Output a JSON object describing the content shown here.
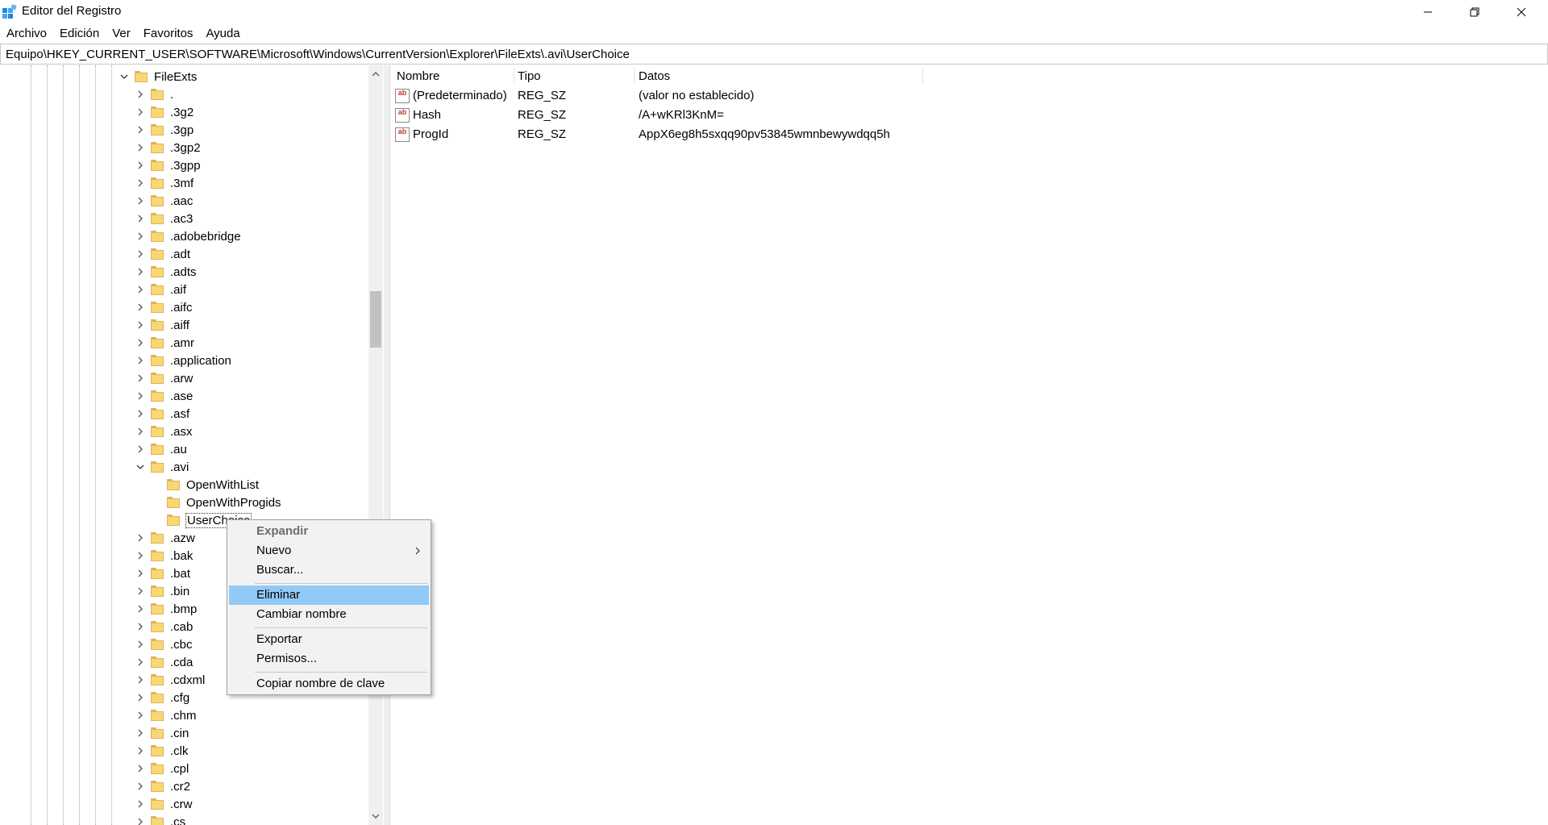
{
  "window": {
    "title": "Editor del Registro"
  },
  "menu": [
    "Archivo",
    "Edición",
    "Ver",
    "Favoritos",
    "Ayuda"
  ],
  "address": "Equipo\\HKEY_CURRENT_USER\\SOFTWARE\\Microsoft\\Windows\\CurrentVersion\\Explorer\\FileExts\\.avi\\UserChoice",
  "tree": {
    "root": "FileExts",
    "items": [
      ".",
      ".3g2",
      ".3gp",
      ".3gp2",
      ".3gpp",
      ".3mf",
      ".aac",
      ".ac3",
      ".adobebridge",
      ".adt",
      ".adts",
      ".aif",
      ".aifc",
      ".aiff",
      ".amr",
      ".application",
      ".arw",
      ".ase",
      ".asf",
      ".asx",
      ".au",
      ".avi"
    ],
    "avi_children": [
      "OpenWithList",
      "OpenWithProgids",
      "UserChoice"
    ],
    "items_after": [
      ".azw",
      ".bak",
      ".bat",
      ".bin",
      ".bmp",
      ".cab",
      ".cbc",
      ".cda",
      ".cdxml",
      ".cfg",
      ".chm",
      ".cin",
      ".clk",
      ".cpl",
      ".cr2",
      ".crw",
      ".cs"
    ]
  },
  "values": {
    "columns": [
      "Nombre",
      "Tipo",
      "Datos"
    ],
    "rows": [
      {
        "name": "(Predeterminado)",
        "type": "REG_SZ",
        "data": "(valor no establecido)"
      },
      {
        "name": "Hash",
        "type": "REG_SZ",
        "data": "/A+wKRl3KnM="
      },
      {
        "name": "ProgId",
        "type": "REG_SZ",
        "data": "AppX6eg8h5sxqq90pv53845wmnbewywdqq5h"
      }
    ]
  },
  "icon_text": "ab",
  "context_menu": {
    "expand": "Expandir",
    "new": "Nuevo",
    "find": "Buscar...",
    "delete": "Eliminar",
    "rename": "Cambiar nombre",
    "export": "Exportar",
    "permissions": "Permisos...",
    "copy_key": "Copiar nombre de clave"
  },
  "colors": {
    "menu_highlight": "#91c9f7",
    "folder": "#f8d775"
  }
}
